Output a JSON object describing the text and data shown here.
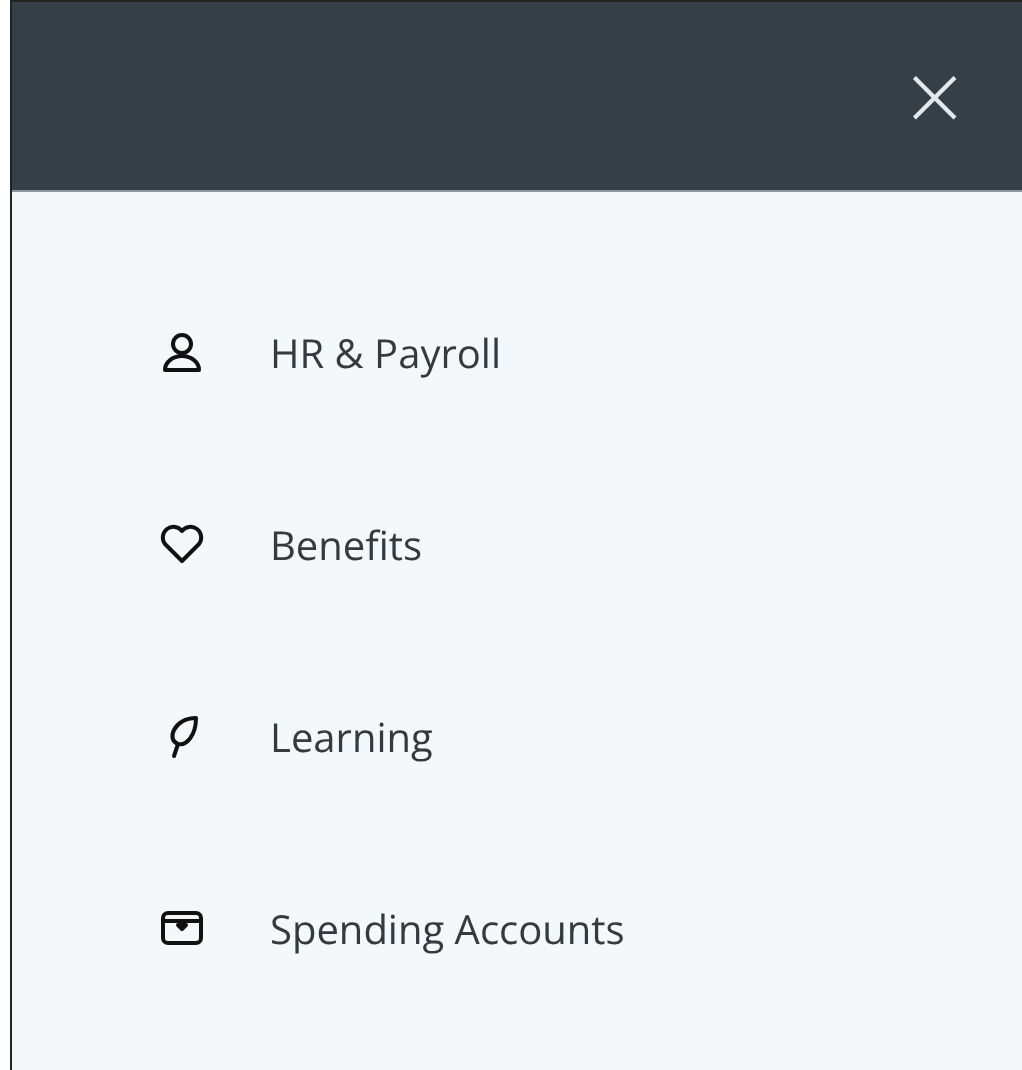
{
  "header": {
    "close_label": "×"
  },
  "menu": [
    {
      "kind": "person",
      "label": "HR & Payroll"
    },
    {
      "kind": "heart",
      "label": "Benefits"
    },
    {
      "kind": "leaf",
      "label": "Learning"
    },
    {
      "kind": "wallet",
      "label": "Spending Accounts"
    }
  ]
}
